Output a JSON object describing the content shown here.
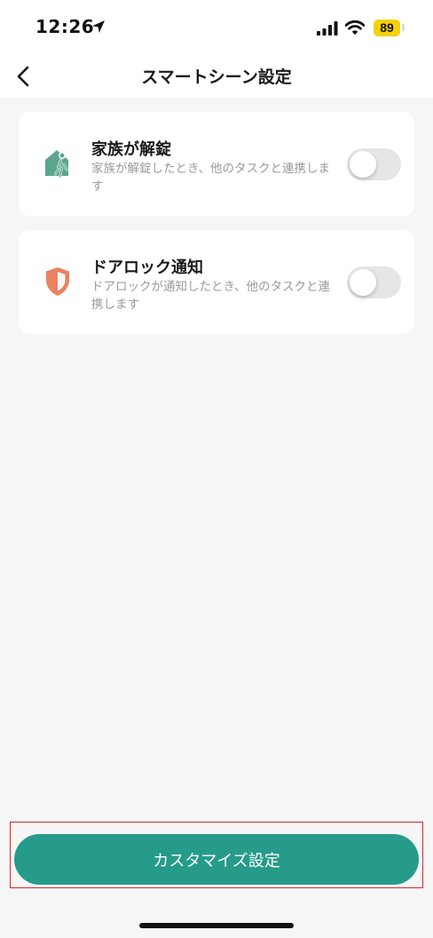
{
  "status_bar": {
    "time": "12:26",
    "battery_level": "89",
    "location_icon": "location-arrow-icon",
    "signal_icon": "cellular-signal-icon",
    "wifi_icon": "wifi-icon"
  },
  "header": {
    "title": "スマートシーン設定",
    "back_icon": "chevron-left-icon"
  },
  "scenes": [
    {
      "title": "家族が解錠",
      "description": "家族が解錠したとき、他のタスクと連携します",
      "icon": "house-person-icon",
      "icon_color": "#5aa58f",
      "enabled": false
    },
    {
      "title": "ドアロック通知",
      "description": "ドアロックが通知したとき、他のタスクと連携します",
      "icon": "shield-icon",
      "icon_color": "#ea8161",
      "enabled": false
    }
  ],
  "footer": {
    "customize_label": "カスタマイズ設定"
  },
  "colors": {
    "accent": "#269b8a",
    "background": "#f6f6f6",
    "card": "#ffffff",
    "toggle_off": "#e6e6e6",
    "highlight_frame": "#d6282e",
    "battery": "#f5d10c"
  }
}
